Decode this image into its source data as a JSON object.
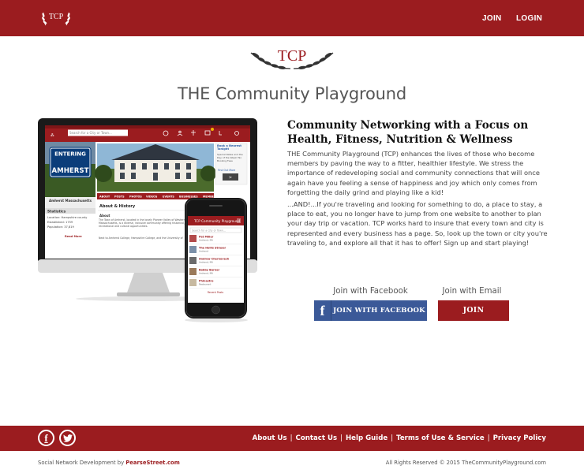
{
  "header": {
    "logo_text": "TCP",
    "nav": {
      "join": "JOIN",
      "login": "LOGIN"
    }
  },
  "brand": {
    "mark_text": "TCP",
    "name": "THE Community Playground"
  },
  "mockup": {
    "desktop": {
      "search_placeholder": "Search for a City or Town...",
      "town_sign_top": "ENTERING",
      "town_sign_name": "AMHERST",
      "town_caption": "Amherst Massachusetts",
      "stats_title": "Statistics",
      "stats": [
        "Location: Hampshire county",
        "Established: 1759",
        "Population: 37,819"
      ],
      "read_more": "Read More",
      "tabs": [
        "ABOUT",
        "POSTS",
        "PHOTOS",
        "VIDEOS",
        "EVENTS",
        "BUSINESSES",
        "MEMBERS"
      ],
      "section_title": "About & History",
      "about_heading": "About",
      "about_text": "The Town of Amherst, located in the lovely Pioneer Valley of Western Massachusetts, is a diverse, inclusive community offering historical, recreational and cultural opportunities.",
      "about_text2": "Next to Amherst College, Hampshire College, and the University of",
      "ad_title": "Book a Nearest Tonight",
      "ad_text": "Special Rates and the Day of the Week! No Booking Fees",
      "ad_more": "Find Out More",
      "ad_next": ">"
    },
    "phone": {
      "title": "TCP Community Playground",
      "search_placeholder": "Search for a City or Town...",
      "posts": [
        {
          "name": "Pat Miller",
          "sub": "Amherst, MA"
        },
        {
          "name": "The Hollis Strayer",
          "sub": "Amherst"
        },
        {
          "name": "Andrew Chernovech",
          "sub": "Amherst, MA"
        },
        {
          "name": "Bobby Burner",
          "sub": "Amherst, MA"
        },
        {
          "name": "Phinastro",
          "sub": "Restaurant"
        }
      ],
      "more": "Recent Posts"
    }
  },
  "content": {
    "heading": "Community Networking with a Focus on Health, Fitness, Nutrition & Wellness",
    "para1": "THE Community Playground (TCP) enhances the lives of those who become members by paving the way to a fitter, healthier lifestyle. We stress the importance of redeveloping social and community connections that will once again have you feeling a sense of happiness and joy which only comes from forgetting the daily grind and playing like a kid!",
    "para2": "...AND!...If you're traveling and looking for something to do, a place to stay, a place to eat, you no longer have to jump from one website to another to plan your day trip or vacation. TCP works hard to insure that every town and city is represented and every business has a page. So, look up the town or city you're traveling to, and explore all that it has to offer! Sign up and start playing!"
  },
  "join": {
    "facebook_title": "Join with Facebook",
    "facebook_button": "JOIN WITH FACEBOOK",
    "facebook_icon": "f",
    "email_title": "Join with Email",
    "email_button": "JOIN"
  },
  "footer": {
    "social_fb": "f",
    "links": [
      "About Us",
      "Contact Us",
      "Help Guide",
      "Terms of Use & Service",
      "Privacy Policy"
    ],
    "separator": "|",
    "credit_prefix": "Social Network Development by",
    "credit_link": "PearseStreet.com",
    "copyright": "All Rights Reserved © 2015 TheCommunityPlayground.com"
  },
  "colors": {
    "brand_red": "#9b1c1f",
    "facebook_blue": "#3b5998"
  }
}
